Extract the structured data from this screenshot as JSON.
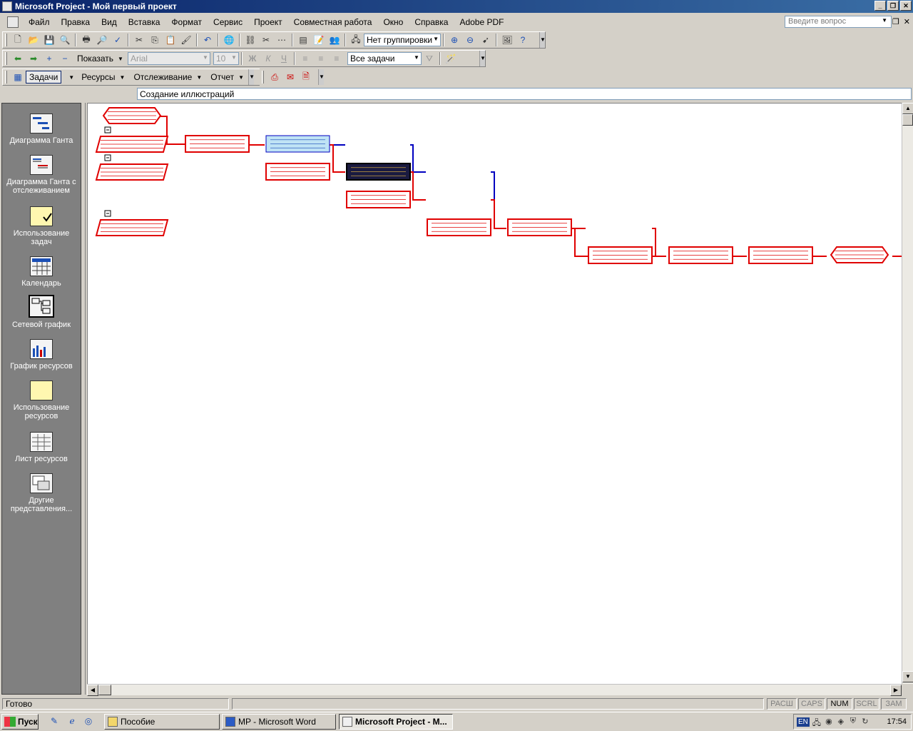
{
  "window": {
    "title": "Microsoft Project - Мой первый проект"
  },
  "menu": [
    "Файл",
    "Правка",
    "Вид",
    "Вставка",
    "Формат",
    "Сервис",
    "Проект",
    "Совместная работа",
    "Окно",
    "Справка",
    "Adobe PDF"
  ],
  "ask_placeholder": "Введите вопрос",
  "toolbar1": {
    "grouping": "Нет группировки"
  },
  "toolbar2": {
    "show_label": "Показать",
    "font": "Arial",
    "font_size": "10",
    "bold": "Ж",
    "italic": "К",
    "underline": "Ч",
    "filter": "Все задачи"
  },
  "toolbar3": {
    "tasks": "Задачи",
    "resources": "Ресурсы",
    "tracking": "Отслеживание",
    "report": "Отчет"
  },
  "entry_value": "Создание иллюстраций",
  "view_bar": [
    {
      "label": "Диаграмма Ганта",
      "icon": "gantt-chart-icon"
    },
    {
      "label": "Диаграмма Ганта с отслеживанием",
      "icon": "tracking-gantt-icon"
    },
    {
      "label": "Использование задач",
      "icon": "task-usage-icon"
    },
    {
      "label": "Календарь",
      "icon": "calendar-icon"
    },
    {
      "label": "Сетевой график",
      "icon": "network-diagram-icon",
      "active": true
    },
    {
      "label": "График ресурсов",
      "icon": "resource-graph-icon"
    },
    {
      "label": "Использование ресурсов",
      "icon": "resource-usage-icon"
    },
    {
      "label": "Лист ресурсов",
      "icon": "resource-sheet-icon"
    },
    {
      "label": "Другие представления...",
      "icon": "more-views-icon"
    }
  ],
  "status": {
    "text": "Готово",
    "keys": [
      "РАСШ",
      "CAPS",
      "NUM",
      "SCRL",
      "ЗАМ"
    ],
    "active_key": "NUM"
  },
  "taskbar": {
    "start": "Пуск",
    "buttons": [
      "Пособие",
      "MP - Microsoft Word",
      "Microsoft Project - M..."
    ],
    "lang": "EN",
    "clock": "17:54"
  },
  "colors": {
    "critical": "#e00000",
    "link": "#0000c0",
    "selected_fill": "#bfe3f5",
    "summary_fill": "#1a1a40"
  }
}
